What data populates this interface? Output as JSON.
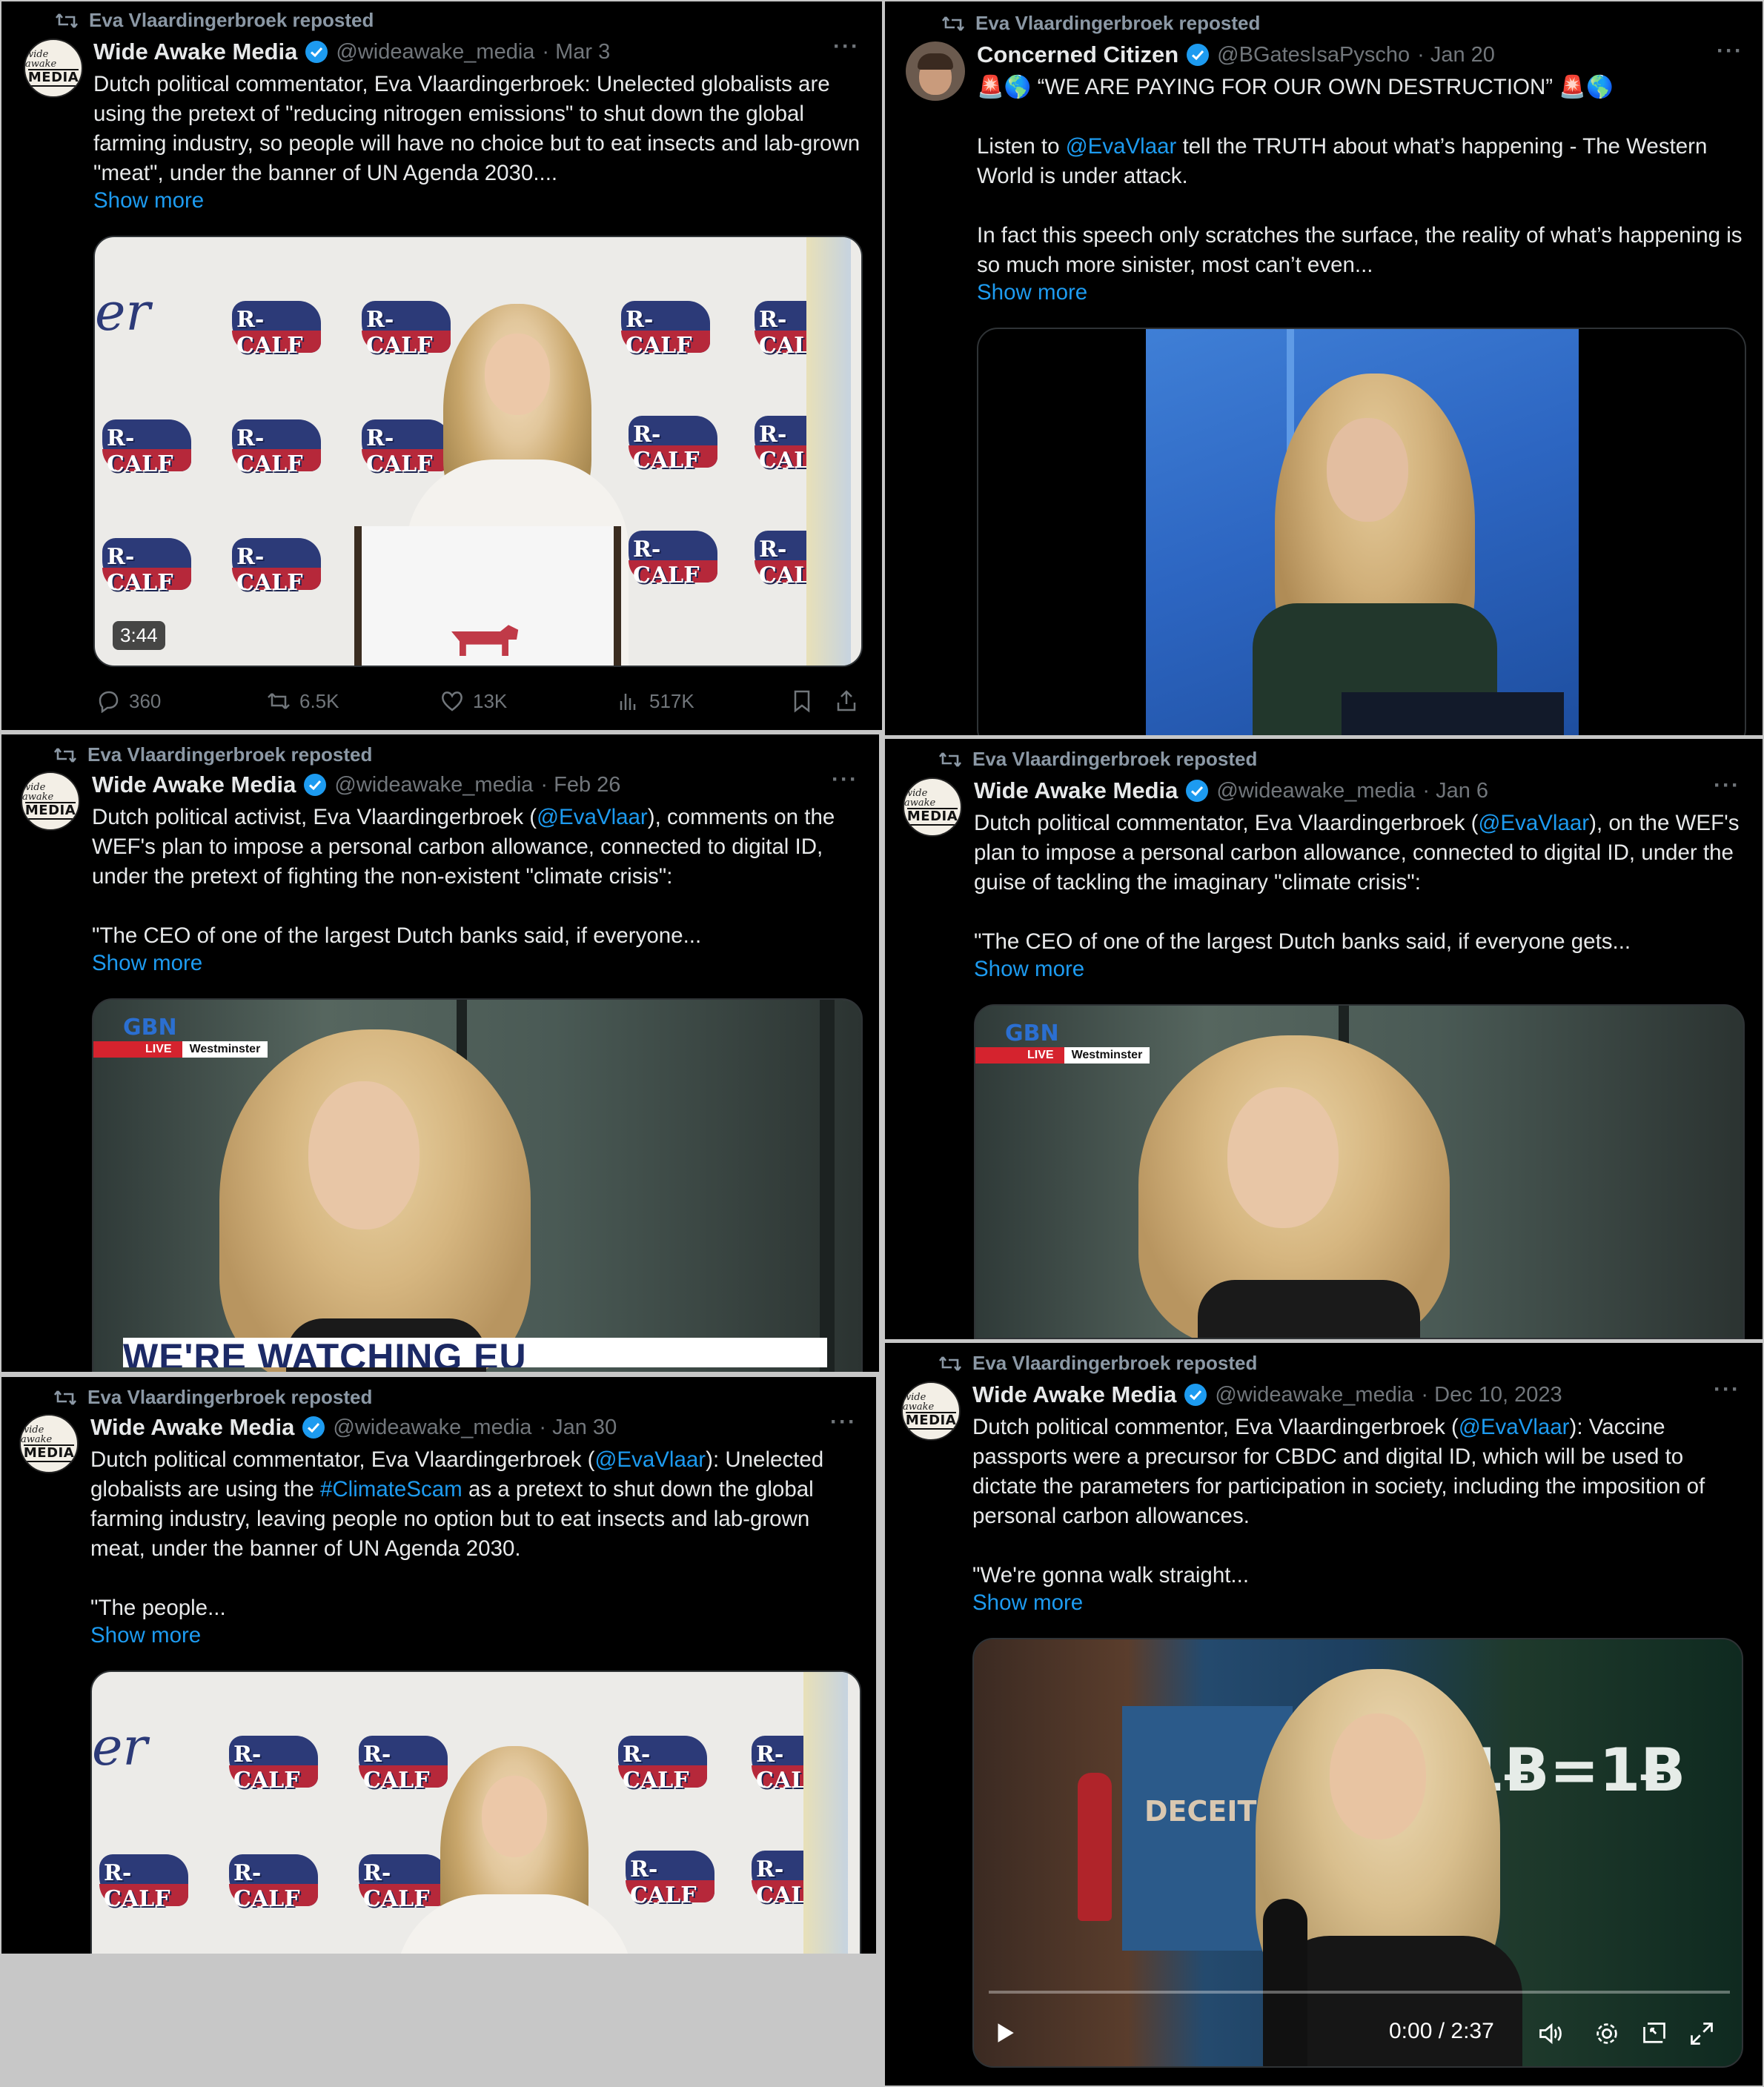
{
  "posts": [
    {
      "reposted_by": "Eva Vlaardingerbroek reposted",
      "author": "Wide Awake Media",
      "handle": "@wideawake_media",
      "date": "· Mar 3",
      "avatar_top": "wide awake",
      "avatar_main": "MEDIA",
      "text": "Dutch political commentator, Eva Vlaardingerbroek: Unelected globalists are using the pretext of \"reducing nitrogen emissions\" to shut down the global farming industry, so people will have no choice but to eat insects and lab-grown \"meat\", under the banner of UN Agenda 2030....",
      "show_more": "Show more",
      "duration": "3:44",
      "stats": {
        "replies": "360",
        "reposts": "6.5K",
        "likes": "13K",
        "views": "517K"
      }
    },
    {
      "reposted_by": "Eva Vlaardingerbroek reposted",
      "author": "Concerned Citizen",
      "handle": "@BGatesIsaPyscho",
      "date": "· Jan 20",
      "text_line1": "🚨🌎 “WE ARE PAYING FOR OUR OWN DESTRUCTION” 🚨🌎",
      "text_listen_pre": "Listen to ",
      "text_listen_link": "@EvaVlaar",
      "text_listen_post": " tell the TRUTH about what’s happening - The Western World is under attack.",
      "text_para2": "In fact this speech only scratches the surface, the reality of what’s happening is so much more sinister, most can’t even...",
      "show_more": "Show more"
    },
    {
      "reposted_by": "Eva Vlaardingerbroek reposted",
      "author": "Wide Awake Media",
      "handle": "@wideawake_media",
      "date": "· Feb 26",
      "avatar_top": "wide awake",
      "avatar_main": "MEDIA",
      "text_pre": "Dutch political activist, Eva Vlaardingerbroek (",
      "text_link": "@EvaVlaar",
      "text_post": "), comments on the WEF's plan to impose a personal carbon allowance, connected to digital ID, under the pretext of fighting the non-existent \"climate crisis\":",
      "text_quote": "\"The CEO of one of the largest Dutch banks said, if everyone...",
      "show_more": "Show more",
      "gbn": "GBN",
      "live": "LIVE",
      "location": "Westminster",
      "ticker": "WE'RE WATCHING EU"
    },
    {
      "reposted_by": "Eva Vlaardingerbroek reposted",
      "author": "Wide Awake Media",
      "handle": "@wideawake_media",
      "date": "· Jan 6",
      "avatar_top": "wide awake",
      "avatar_main": "MEDIA",
      "text_pre": "Dutch political commentator, Eva Vlaardingerbroek (",
      "text_link": "@EvaVlaar",
      "text_post": "), on the WEF's plan to impose a personal carbon allowance, connected to digital ID, under the guise of tackling the imaginary \"climate crisis\":",
      "text_quote": "\"The CEO of one of the largest Dutch banks said, if everyone gets...",
      "show_more": "Show more",
      "gbn": "GBN",
      "live": "LIVE",
      "location": "Westminster"
    },
    {
      "reposted_by": "Eva Vlaardingerbroek reposted",
      "author": "Wide Awake Media",
      "handle": "@wideawake_media",
      "date": "· Jan 30",
      "avatar_top": "wide awake",
      "avatar_main": "MEDIA",
      "text_pre": "Dutch political commentator, Eva Vlaardingerbroek (",
      "text_link": "@EvaVlaar",
      "text_mid": "): Unelected globalists are using the ",
      "text_hashtag": "#ClimateScam",
      "text_post": " as a pretext to shut down the global farming industry, leaving people no option but to eat insects and lab-grown meat, under the banner of UN Agenda 2030.",
      "text_quote": "\"The people...",
      "show_more": "Show more"
    },
    {
      "reposted_by": "Eva Vlaardingerbroek reposted",
      "author": "Wide Awake Media",
      "handle": "@wideawake_media",
      "date": "· Dec 10, 2023",
      "avatar_top": "wide awake",
      "avatar_main": "MEDIA",
      "text_pre": "Dutch political commentor, Eva Vlaardingerbroek (",
      "text_link": "@EvaVlaar",
      "text_post": "): Vaccine passports were a precursor for CBDC and digital ID, which will be used to dictate the parameters for participation in society, including the imposition of personal carbon allowances.",
      "text_quote": "\"We're gonna walk straight...",
      "show_more": "Show more",
      "video_time": "0:00 / 2:37",
      "video_progress": 0,
      "wall_text": "1Ƀ=1Ƀ",
      "poster_text": "DECEIT"
    }
  ],
  "rcalf_label": "R-CALF",
  "colors": {
    "tile_bg": "#000000",
    "link": "#1d9bf0",
    "muted": "#71767b",
    "verified": "#1d9bf0",
    "page_bg": "#c7c7c7"
  },
  "icons": [
    "repost-icon",
    "verified-badge-icon",
    "more-icon",
    "reply-icon",
    "like-icon",
    "views-icon",
    "bookmark-icon",
    "share-icon",
    "play-icon",
    "volume-icon",
    "settings-icon",
    "pip-icon",
    "fullscreen-icon"
  ]
}
